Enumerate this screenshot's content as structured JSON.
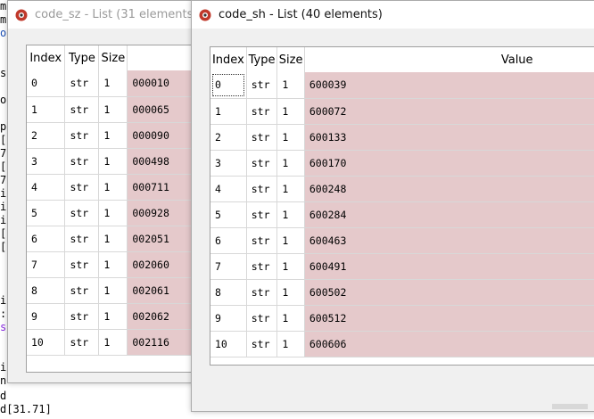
{
  "console": {
    "lines": [
      {
        "text": "m",
        "cls": ""
      },
      {
        "text": "m",
        "cls": ""
      },
      {
        "text": "o",
        "cls": "c-blue"
      },
      {
        "text": "",
        "cls": ""
      },
      {
        "text": "",
        "cls": ""
      },
      {
        "text": "s",
        "cls": ""
      },
      {
        "text": "",
        "cls": ""
      },
      {
        "text": "o",
        "cls": ""
      },
      {
        "text": "",
        "cls": ""
      },
      {
        "text": "p",
        "cls": ""
      },
      {
        "text": "[",
        "cls": ""
      },
      {
        "text": "7",
        "cls": ""
      },
      {
        "text": "[",
        "cls": ""
      },
      {
        "text": "7",
        "cls": ""
      },
      {
        "text": "i",
        "cls": ""
      },
      {
        "text": "i",
        "cls": ""
      },
      {
        "text": "i",
        "cls": ""
      },
      {
        "text": "[",
        "cls": ""
      },
      {
        "text": "[",
        "cls": ""
      },
      {
        "text": "",
        "cls": ""
      },
      {
        "text": "",
        "cls": ""
      },
      {
        "text": "",
        "cls": ""
      },
      {
        "text": "i",
        "cls": ""
      },
      {
        "text": ":",
        "cls": ""
      },
      {
        "text": "s",
        "cls": "c-purple"
      },
      {
        "text": "",
        "cls": ""
      },
      {
        "text": "",
        "cls": ""
      },
      {
        "text": "i",
        "cls": ""
      },
      {
        "text": "n",
        "cls": ""
      }
    ],
    "bottom": [
      "d",
      "d[31.71]"
    ]
  },
  "window_sz": {
    "title": "code_sz - List (31 elements)",
    "headers": {
      "index": "Index",
      "type": "Type",
      "size": "Size"
    },
    "rows": [
      {
        "index": "0",
        "type": "str",
        "size": "1",
        "value": "000010"
      },
      {
        "index": "1",
        "type": "str",
        "size": "1",
        "value": "000065"
      },
      {
        "index": "2",
        "type": "str",
        "size": "1",
        "value": "000090"
      },
      {
        "index": "3",
        "type": "str",
        "size": "1",
        "value": "000498"
      },
      {
        "index": "4",
        "type": "str",
        "size": "1",
        "value": "000711"
      },
      {
        "index": "5",
        "type": "str",
        "size": "1",
        "value": "000928"
      },
      {
        "index": "6",
        "type": "str",
        "size": "1",
        "value": "002051"
      },
      {
        "index": "7",
        "type": "str",
        "size": "1",
        "value": "002060"
      },
      {
        "index": "8",
        "type": "str",
        "size": "1",
        "value": "002061"
      },
      {
        "index": "9",
        "type": "str",
        "size": "1",
        "value": "002062"
      },
      {
        "index": "10",
        "type": "str",
        "size": "1",
        "value": "002116"
      }
    ]
  },
  "window_sh": {
    "title": "code_sh - List (40 elements)",
    "headers": {
      "index": "Index",
      "type": "Type",
      "size": "Size",
      "value": "Value"
    },
    "rows": [
      {
        "index": "0",
        "type": "str",
        "size": "1",
        "value": "600039"
      },
      {
        "index": "1",
        "type": "str",
        "size": "1",
        "value": "600072"
      },
      {
        "index": "2",
        "type": "str",
        "size": "1",
        "value": "600133"
      },
      {
        "index": "3",
        "type": "str",
        "size": "1",
        "value": "600170"
      },
      {
        "index": "4",
        "type": "str",
        "size": "1",
        "value": "600248"
      },
      {
        "index": "5",
        "type": "str",
        "size": "1",
        "value": "600284"
      },
      {
        "index": "6",
        "type": "str",
        "size": "1",
        "value": "600463"
      },
      {
        "index": "7",
        "type": "str",
        "size": "1",
        "value": "600491"
      },
      {
        "index": "8",
        "type": "str",
        "size": "1",
        "value": "600502"
      },
      {
        "index": "9",
        "type": "str",
        "size": "1",
        "value": "600512"
      },
      {
        "index": "10",
        "type": "str",
        "size": "1",
        "value": "600606"
      }
    ]
  },
  "colors": {
    "value_cell": "#e5c9cb",
    "title_inactive": "#9a9a9a"
  }
}
